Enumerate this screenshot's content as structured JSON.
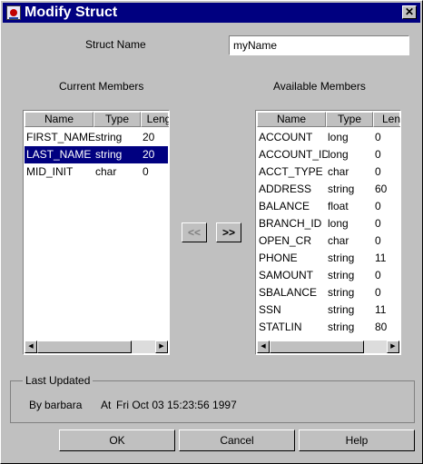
{
  "window": {
    "title": "Modify Struct",
    "close_glyph": "✕",
    "icon": "app-icon"
  },
  "struct_name": {
    "label": "Struct Name",
    "value": "myName"
  },
  "current_members": {
    "title": "Current Members",
    "columns": [
      "Name",
      "Type",
      "Leng"
    ],
    "rows": [
      {
        "name": "FIRST_NAME",
        "type": "string",
        "length": "20"
      },
      {
        "name": "LAST_NAME",
        "type": "string",
        "length": "20"
      },
      {
        "name": "MID_INIT",
        "type": "char",
        "length": "0"
      }
    ],
    "selected_row": "LAST_NAME"
  },
  "available_members": {
    "title": "Available Members",
    "columns": [
      "Name",
      "Type",
      "Len"
    ],
    "rows": [
      {
        "name": "ACCOUNT",
        "type": "long",
        "length": "0"
      },
      {
        "name": "ACCOUNT_ID",
        "type": "long",
        "length": "0"
      },
      {
        "name": "ACCT_TYPE",
        "type": "char",
        "length": "0"
      },
      {
        "name": "ADDRESS",
        "type": "string",
        "length": "60"
      },
      {
        "name": "BALANCE",
        "type": "float",
        "length": "0"
      },
      {
        "name": "BRANCH_ID",
        "type": "long",
        "length": "0"
      },
      {
        "name": "OPEN_CR",
        "type": "char",
        "length": "0"
      },
      {
        "name": "PHONE",
        "type": "string",
        "length": "11"
      },
      {
        "name": "SAMOUNT",
        "type": "string",
        "length": "0"
      },
      {
        "name": "SBALANCE",
        "type": "string",
        "length": "0"
      },
      {
        "name": "SSN",
        "type": "string",
        "length": "11"
      },
      {
        "name": "STATLIN",
        "type": "string",
        "length": "80"
      }
    ]
  },
  "move_buttons": {
    "move_left": "<<",
    "move_right": ">>"
  },
  "last_updated": {
    "title": "Last Updated",
    "by_label": "By",
    "by_value": "barbara",
    "at_label": "At",
    "at_value": "Fri Oct 03 15:23:56  1997"
  },
  "buttons": {
    "ok": "OK",
    "cancel": "Cancel",
    "help": "Help"
  },
  "scroll_glyphs": {
    "left": "◀",
    "right": "▶"
  },
  "colors": {
    "title_bar": "#000080",
    "selection": "#000080",
    "face": "#c0c0c0"
  }
}
